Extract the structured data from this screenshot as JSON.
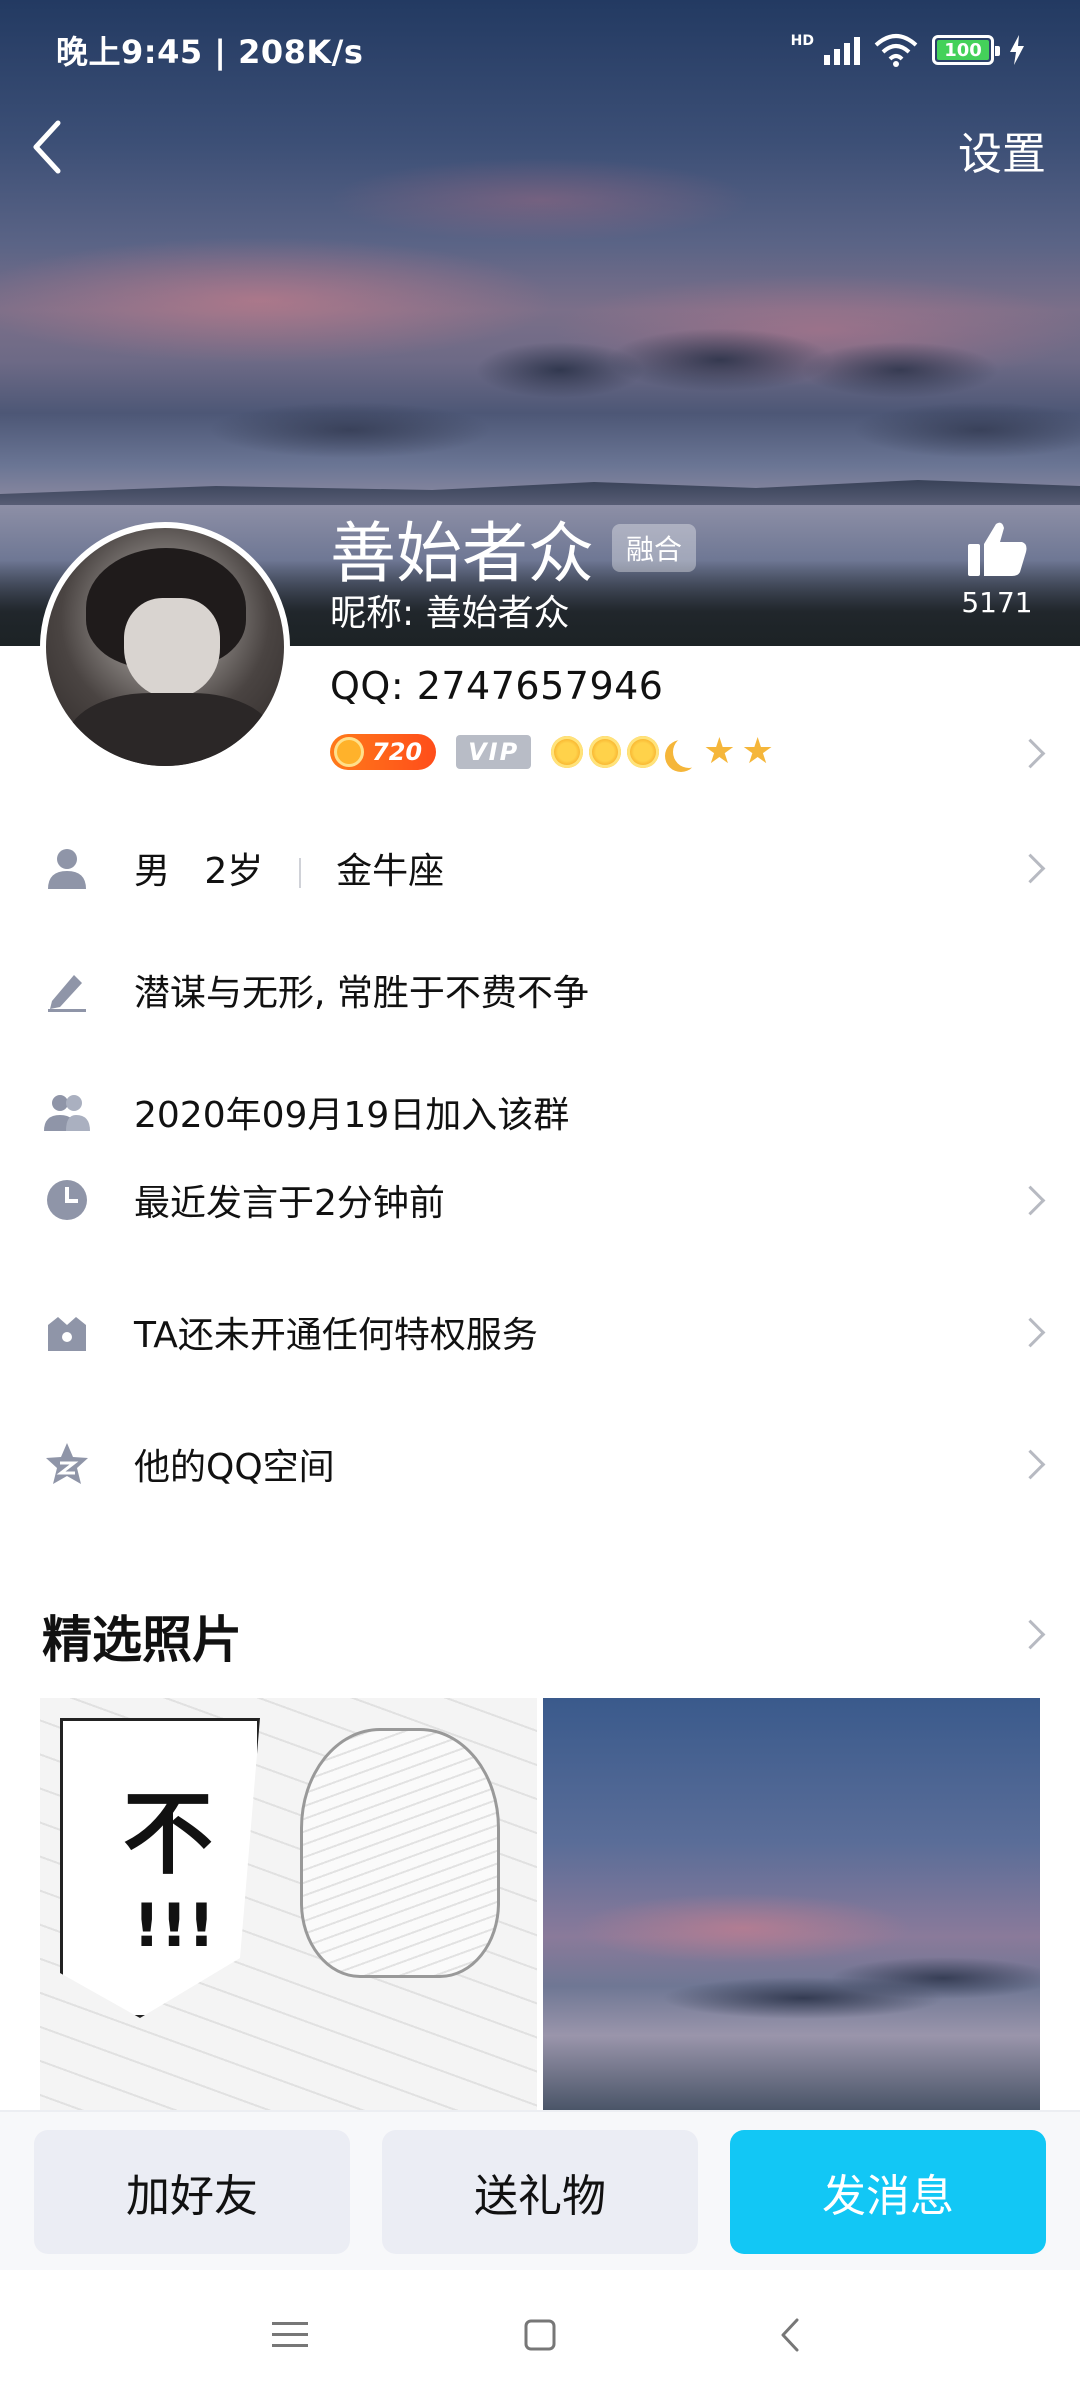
{
  "status_bar": {
    "time": "晚上9:45 | 208K/s",
    "network": "HD",
    "battery": "100"
  },
  "header": {
    "settings_label": "设置",
    "display_name": "善始者众",
    "tag": "融合",
    "nickname": "昵称: 善始者众",
    "like_count": "5171"
  },
  "profile": {
    "qq": "QQ: 2747657946",
    "level_badge": "720",
    "vip_badge": "VIP"
  },
  "info_rows": {
    "gender": "男",
    "age": "2岁",
    "zodiac": "金牛座",
    "signature": "潜谋与无形, 常胜于不费不争",
    "join_date": "2020年09月19日加入该群",
    "last_active": "最近发言于2分钟前",
    "privileges": "TA还未开通任何特权服务",
    "qzone": "他的QQ空间"
  },
  "photos": {
    "title": "精选照片",
    "manga_text_1": "不",
    "manga_text_2": "!!!"
  },
  "actions": {
    "add_friend": "加好友",
    "send_gift": "送礼物",
    "send_message": "发消息"
  },
  "colors": {
    "accent": "#12c7f5",
    "secondary_button": "#ebedf4",
    "icon_gray": "#8f95a8"
  }
}
